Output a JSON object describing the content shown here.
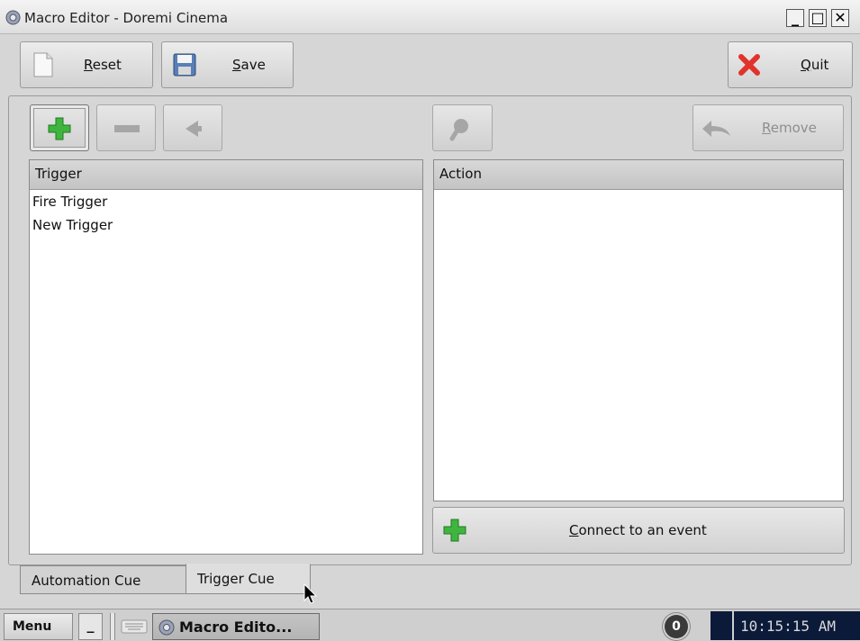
{
  "window": {
    "title": "Macro Editor - Doremi Cinema",
    "minimize_glyph": "_",
    "maximize_glyph": "□",
    "close_glyph": "✕"
  },
  "toolbar": {
    "reset": {
      "pre": "",
      "mnemonic": "R",
      "post": "eset",
      "icon": "document-icon"
    },
    "save": {
      "pre": "",
      "mnemonic": "S",
      "post": "ave",
      "icon": "floppy-disk-icon"
    },
    "quit": {
      "pre": "",
      "mnemonic": "Q",
      "post": "uit",
      "icon": "red-x-icon"
    }
  },
  "trigger_actions": {
    "add_icon": "plus-icon",
    "remove_icon": "minus-icon",
    "fire_icon": "bell-icon"
  },
  "action_actions": {
    "search_icon": "magnifier-icon",
    "remove": {
      "pre": "",
      "mnemonic": "R",
      "post": "emove",
      "icon": "undo-arrow-icon"
    }
  },
  "trigger_list": {
    "header": "Trigger",
    "items": [
      "Fire Trigger",
      "New Trigger"
    ]
  },
  "action_list": {
    "header": "Action",
    "items": []
  },
  "connect_button": {
    "pre": "",
    "mnemonic": "C",
    "post": "onnect to an event",
    "icon": "plus-icon"
  },
  "tabs": [
    {
      "label": "Automation Cue",
      "active": false
    },
    {
      "label": "Trigger Cue",
      "active": true
    }
  ],
  "taskbar": {
    "menu_label": "Menu",
    "minimize_label": "_",
    "task_label": "Macro Edito...",
    "badge_count": "0",
    "clock": "10:15:15 AM"
  },
  "colors": {
    "plus_green": "#3fb53f",
    "quit_red": "#e0332b",
    "clock_bg": "#0c1a3a",
    "clock_fg": "#d8d8d8"
  }
}
